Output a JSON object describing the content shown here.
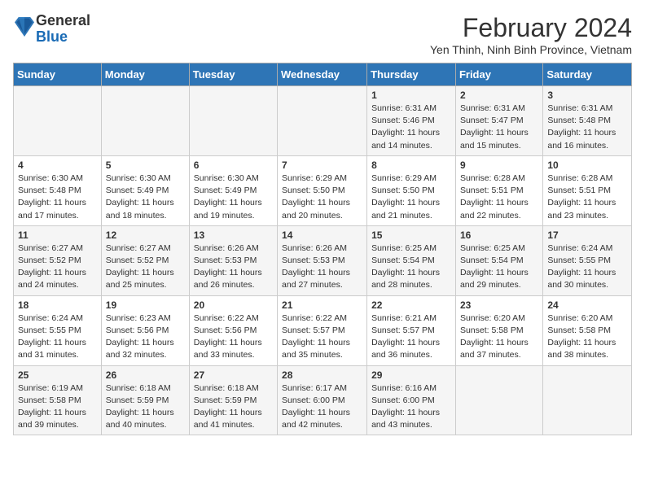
{
  "logo": {
    "general": "General",
    "blue": "Blue"
  },
  "header": {
    "month_title": "February 2024",
    "subtitle": "Yen Thinh, Ninh Binh Province, Vietnam"
  },
  "days_of_week": [
    "Sunday",
    "Monday",
    "Tuesday",
    "Wednesday",
    "Thursday",
    "Friday",
    "Saturday"
  ],
  "weeks": [
    [
      {
        "day": "",
        "info": ""
      },
      {
        "day": "",
        "info": ""
      },
      {
        "day": "",
        "info": ""
      },
      {
        "day": "",
        "info": ""
      },
      {
        "day": "1",
        "info": "Sunrise: 6:31 AM\nSunset: 5:46 PM\nDaylight: 11 hours and 14 minutes."
      },
      {
        "day": "2",
        "info": "Sunrise: 6:31 AM\nSunset: 5:47 PM\nDaylight: 11 hours and 15 minutes."
      },
      {
        "day": "3",
        "info": "Sunrise: 6:31 AM\nSunset: 5:48 PM\nDaylight: 11 hours and 16 minutes."
      }
    ],
    [
      {
        "day": "4",
        "info": "Sunrise: 6:30 AM\nSunset: 5:48 PM\nDaylight: 11 hours and 17 minutes."
      },
      {
        "day": "5",
        "info": "Sunrise: 6:30 AM\nSunset: 5:49 PM\nDaylight: 11 hours and 18 minutes."
      },
      {
        "day": "6",
        "info": "Sunrise: 6:30 AM\nSunset: 5:49 PM\nDaylight: 11 hours and 19 minutes."
      },
      {
        "day": "7",
        "info": "Sunrise: 6:29 AM\nSunset: 5:50 PM\nDaylight: 11 hours and 20 minutes."
      },
      {
        "day": "8",
        "info": "Sunrise: 6:29 AM\nSunset: 5:50 PM\nDaylight: 11 hours and 21 minutes."
      },
      {
        "day": "9",
        "info": "Sunrise: 6:28 AM\nSunset: 5:51 PM\nDaylight: 11 hours and 22 minutes."
      },
      {
        "day": "10",
        "info": "Sunrise: 6:28 AM\nSunset: 5:51 PM\nDaylight: 11 hours and 23 minutes."
      }
    ],
    [
      {
        "day": "11",
        "info": "Sunrise: 6:27 AM\nSunset: 5:52 PM\nDaylight: 11 hours and 24 minutes."
      },
      {
        "day": "12",
        "info": "Sunrise: 6:27 AM\nSunset: 5:52 PM\nDaylight: 11 hours and 25 minutes."
      },
      {
        "day": "13",
        "info": "Sunrise: 6:26 AM\nSunset: 5:53 PM\nDaylight: 11 hours and 26 minutes."
      },
      {
        "day": "14",
        "info": "Sunrise: 6:26 AM\nSunset: 5:53 PM\nDaylight: 11 hours and 27 minutes."
      },
      {
        "day": "15",
        "info": "Sunrise: 6:25 AM\nSunset: 5:54 PM\nDaylight: 11 hours and 28 minutes."
      },
      {
        "day": "16",
        "info": "Sunrise: 6:25 AM\nSunset: 5:54 PM\nDaylight: 11 hours and 29 minutes."
      },
      {
        "day": "17",
        "info": "Sunrise: 6:24 AM\nSunset: 5:55 PM\nDaylight: 11 hours and 30 minutes."
      }
    ],
    [
      {
        "day": "18",
        "info": "Sunrise: 6:24 AM\nSunset: 5:55 PM\nDaylight: 11 hours and 31 minutes."
      },
      {
        "day": "19",
        "info": "Sunrise: 6:23 AM\nSunset: 5:56 PM\nDaylight: 11 hours and 32 minutes."
      },
      {
        "day": "20",
        "info": "Sunrise: 6:22 AM\nSunset: 5:56 PM\nDaylight: 11 hours and 33 minutes."
      },
      {
        "day": "21",
        "info": "Sunrise: 6:22 AM\nSunset: 5:57 PM\nDaylight: 11 hours and 35 minutes."
      },
      {
        "day": "22",
        "info": "Sunrise: 6:21 AM\nSunset: 5:57 PM\nDaylight: 11 hours and 36 minutes."
      },
      {
        "day": "23",
        "info": "Sunrise: 6:20 AM\nSunset: 5:58 PM\nDaylight: 11 hours and 37 minutes."
      },
      {
        "day": "24",
        "info": "Sunrise: 6:20 AM\nSunset: 5:58 PM\nDaylight: 11 hours and 38 minutes."
      }
    ],
    [
      {
        "day": "25",
        "info": "Sunrise: 6:19 AM\nSunset: 5:58 PM\nDaylight: 11 hours and 39 minutes."
      },
      {
        "day": "26",
        "info": "Sunrise: 6:18 AM\nSunset: 5:59 PM\nDaylight: 11 hours and 40 minutes."
      },
      {
        "day": "27",
        "info": "Sunrise: 6:18 AM\nSunset: 5:59 PM\nDaylight: 11 hours and 41 minutes."
      },
      {
        "day": "28",
        "info": "Sunrise: 6:17 AM\nSunset: 6:00 PM\nDaylight: 11 hours and 42 minutes."
      },
      {
        "day": "29",
        "info": "Sunrise: 6:16 AM\nSunset: 6:00 PM\nDaylight: 11 hours and 43 minutes."
      },
      {
        "day": "",
        "info": ""
      },
      {
        "day": "",
        "info": ""
      }
    ]
  ]
}
